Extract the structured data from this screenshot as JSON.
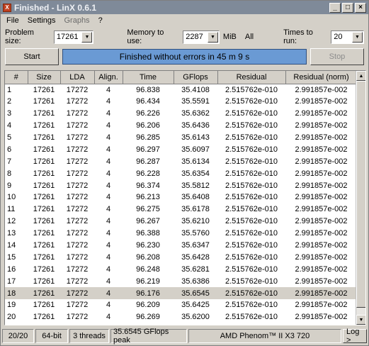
{
  "window": {
    "title": "Finished - LinX 0.6.1"
  },
  "menu": [
    "File",
    "Settings",
    "Graphs",
    "?"
  ],
  "controls": {
    "problem_size_label": "Problem size:",
    "problem_size": "17261",
    "memory_label": "Memory to use:",
    "memory": "2287",
    "memory_unit": "MiB",
    "all_label": "All",
    "times_label": "Times to run:",
    "times": "20"
  },
  "actions": {
    "start": "Start",
    "status": "Finished without errors in 45 m 9 s",
    "stop": "Stop"
  },
  "table": {
    "columns": [
      "#",
      "Size",
      "LDA",
      "Align.",
      "Time",
      "GFlops",
      "Residual",
      "Residual (norm)"
    ],
    "rows": [
      [
        "1",
        "17261",
        "17272",
        "4",
        "96.838",
        "35.4108",
        "2.515762e-010",
        "2.991857e-002"
      ],
      [
        "2",
        "17261",
        "17272",
        "4",
        "96.434",
        "35.5591",
        "2.515762e-010",
        "2.991857e-002"
      ],
      [
        "3",
        "17261",
        "17272",
        "4",
        "96.226",
        "35.6362",
        "2.515762e-010",
        "2.991857e-002"
      ],
      [
        "4",
        "17261",
        "17272",
        "4",
        "96.206",
        "35.6436",
        "2.515762e-010",
        "2.991857e-002"
      ],
      [
        "5",
        "17261",
        "17272",
        "4",
        "96.285",
        "35.6143",
        "2.515762e-010",
        "2.991857e-002"
      ],
      [
        "6",
        "17261",
        "17272",
        "4",
        "96.297",
        "35.6097",
        "2.515762e-010",
        "2.991857e-002"
      ],
      [
        "7",
        "17261",
        "17272",
        "4",
        "96.287",
        "35.6134",
        "2.515762e-010",
        "2.991857e-002"
      ],
      [
        "8",
        "17261",
        "17272",
        "4",
        "96.228",
        "35.6354",
        "2.515762e-010",
        "2.991857e-002"
      ],
      [
        "9",
        "17261",
        "17272",
        "4",
        "96.374",
        "35.5812",
        "2.515762e-010",
        "2.991857e-002"
      ],
      [
        "10",
        "17261",
        "17272",
        "4",
        "96.213",
        "35.6408",
        "2.515762e-010",
        "2.991857e-002"
      ],
      [
        "11",
        "17261",
        "17272",
        "4",
        "96.275",
        "35.6178",
        "2.515762e-010",
        "2.991857e-002"
      ],
      [
        "12",
        "17261",
        "17272",
        "4",
        "96.267",
        "35.6210",
        "2.515762e-010",
        "2.991857e-002"
      ],
      [
        "13",
        "17261",
        "17272",
        "4",
        "96.388",
        "35.5760",
        "2.515762e-010",
        "2.991857e-002"
      ],
      [
        "14",
        "17261",
        "17272",
        "4",
        "96.230",
        "35.6347",
        "2.515762e-010",
        "2.991857e-002"
      ],
      [
        "15",
        "17261",
        "17272",
        "4",
        "96.208",
        "35.6428",
        "2.515762e-010",
        "2.991857e-002"
      ],
      [
        "16",
        "17261",
        "17272",
        "4",
        "96.248",
        "35.6281",
        "2.515762e-010",
        "2.991857e-002"
      ],
      [
        "17",
        "17261",
        "17272",
        "4",
        "96.219",
        "35.6386",
        "2.515762e-010",
        "2.991857e-002"
      ],
      [
        "18",
        "17261",
        "17272",
        "4",
        "96.176",
        "35.6545",
        "2.515762e-010",
        "2.991857e-002"
      ],
      [
        "19",
        "17261",
        "17272",
        "4",
        "96.209",
        "35.6425",
        "2.515762e-010",
        "2.991857e-002"
      ],
      [
        "20",
        "17261",
        "17272",
        "4",
        "96.269",
        "35.6200",
        "2.515762e-010",
        "2.991857e-002"
      ]
    ],
    "selected_row": 18
  },
  "statusbar": {
    "progress": "20/20",
    "bits": "64-bit",
    "threads": "3 threads",
    "peak": "35.6545 GFlops peak",
    "cpu": "AMD Phenom™ II X3 720",
    "log": "Log >"
  },
  "colors": {
    "status_fill": "#6a9ad4",
    "titlebar": "#7f8a99"
  }
}
